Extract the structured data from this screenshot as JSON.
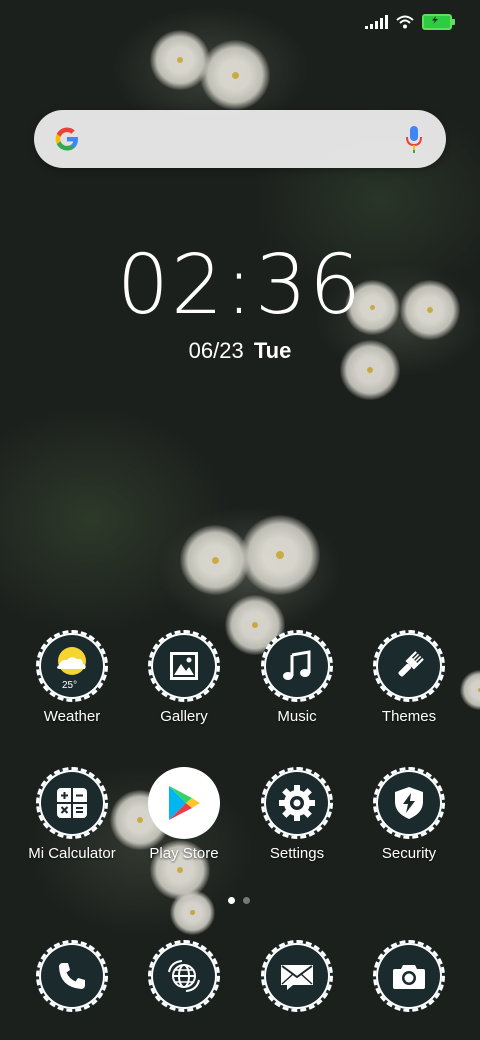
{
  "status_bar": {
    "signal": "signal-icon",
    "wifi": "wifi-icon",
    "battery": "battery-charging-icon",
    "battery_color": "#2ecc40"
  },
  "search": {
    "icon": "google-icon",
    "mic": "mic-icon"
  },
  "clock": {
    "time": "02:36",
    "date": "06/23",
    "day": "Tue"
  },
  "apps": [
    {
      "label": "Weather",
      "icon": "weather-icon",
      "temp": "25°"
    },
    {
      "label": "Gallery",
      "icon": "gallery-icon"
    },
    {
      "label": "Music",
      "icon": "music-note-icon"
    },
    {
      "label": "Themes",
      "icon": "paintbrush-icon"
    },
    {
      "label": "Mi Calculator",
      "icon": "calculator-icon"
    },
    {
      "label": "Play Store",
      "icon": "play-store-icon"
    },
    {
      "label": "Settings",
      "icon": "gear-icon"
    },
    {
      "label": "Security",
      "icon": "shield-icon"
    }
  ],
  "dock": [
    {
      "icon": "phone-icon"
    },
    {
      "icon": "browser-globe-icon"
    },
    {
      "icon": "messages-icon"
    },
    {
      "icon": "camera-icon"
    }
  ],
  "page_indicator": {
    "pages": 2,
    "current": 1
  }
}
